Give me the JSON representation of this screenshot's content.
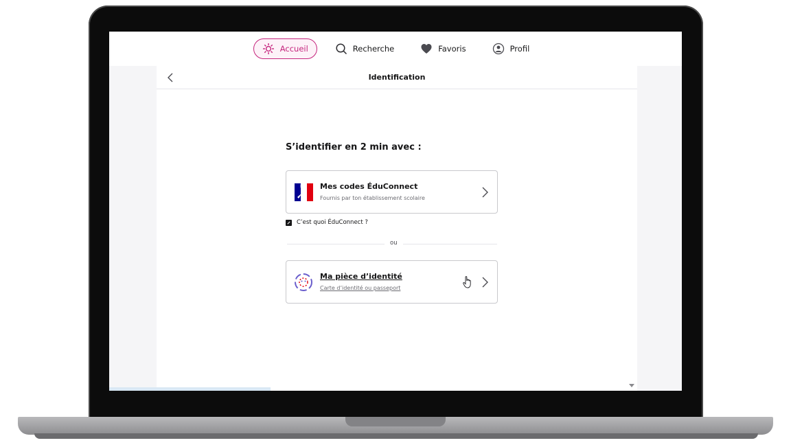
{
  "nav": {
    "items": [
      {
        "label": "Accueil",
        "icon": "sun-icon",
        "active": true
      },
      {
        "label": "Recherche",
        "icon": "search-icon",
        "active": false
      },
      {
        "label": "Favoris",
        "icon": "heart-icon",
        "active": false
      },
      {
        "label": "Profil",
        "icon": "user-icon",
        "active": false
      }
    ]
  },
  "page": {
    "title": "Identification",
    "subtitle": "S’identifier en 2 min avec :"
  },
  "options": {
    "educonnect": {
      "title": "Mes codes ÉduConnect",
      "subtitle": "Fournis par ton établissement scolaire"
    },
    "info_link": "C’est quoi ÉduConnect ?",
    "divider": "ou",
    "identity": {
      "title": "Ma pièce d’identité",
      "subtitle": "Carte d’identité ou passeport"
    }
  },
  "colors": {
    "accent": "#c5247d",
    "republique_blue": "#000091",
    "republique_red": "#e1000f",
    "identity_purple": "#6a5ecc"
  }
}
